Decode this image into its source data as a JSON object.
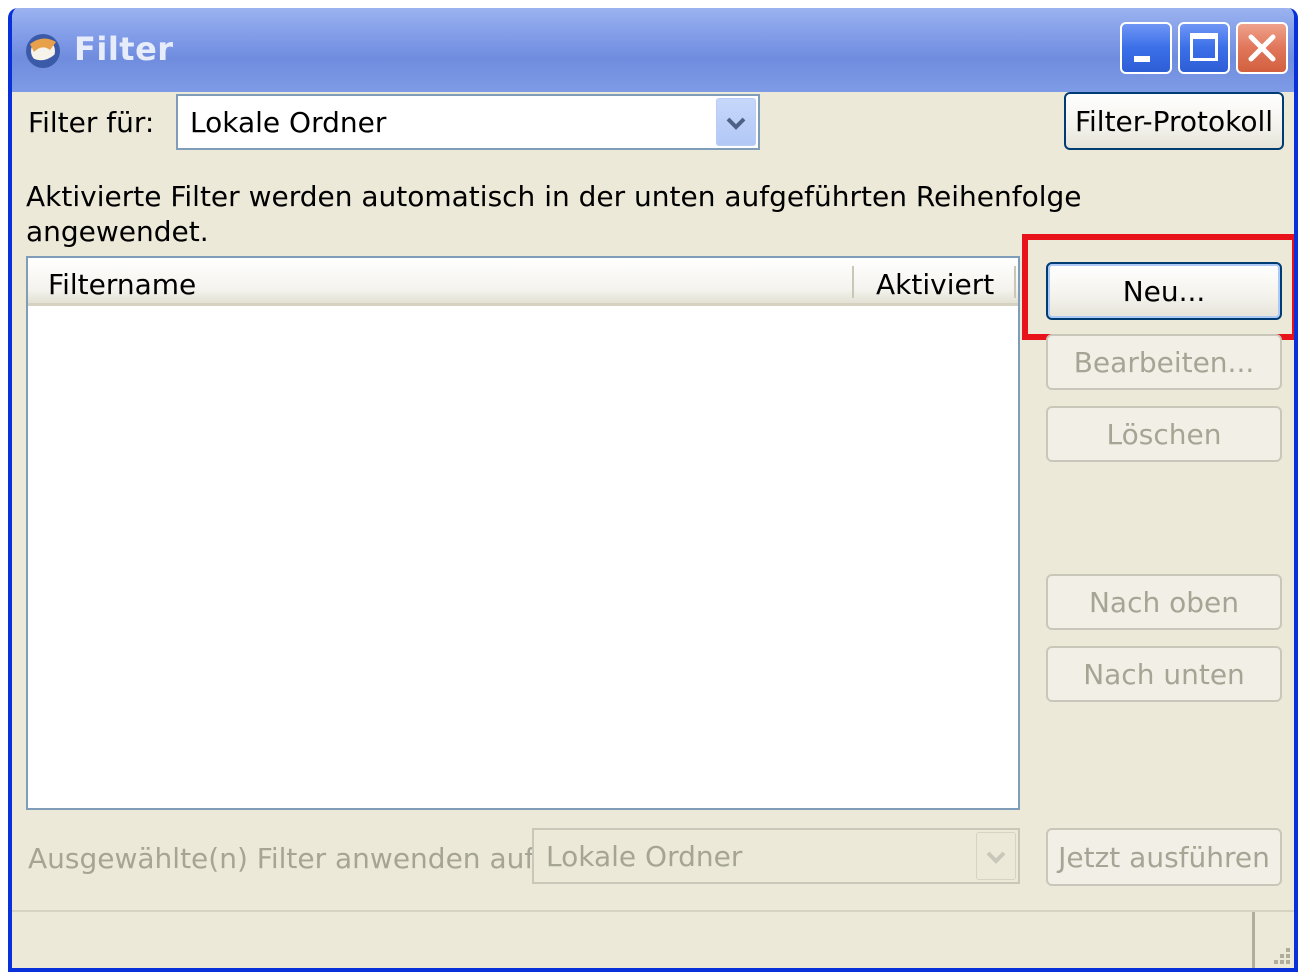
{
  "window": {
    "title": "Filter"
  },
  "filter_for": {
    "label": "Filter für:",
    "value": "Lokale Ordner"
  },
  "buttons": {
    "filter_log": "Filter-Protokoll",
    "new": "Neu...",
    "edit": "Bearbeiten...",
    "delete": "Löschen",
    "move_up": "Nach oben",
    "move_down": "Nach unten",
    "run_now": "Jetzt ausführen"
  },
  "description": {
    "line1": "Aktivierte Filter werden automatisch in der unten aufgeführten Reihenfolge",
    "line2": "angewendet."
  },
  "filter_list": {
    "columns": [
      "Filtername",
      "Aktiviert"
    ],
    "rows": []
  },
  "apply_to": {
    "label": "Ausgewählte(n) Filter anwenden auf:",
    "value": "Lokale Ordner"
  },
  "colors": {
    "highlight": "#e8131a",
    "titlebar": "#7d98e6",
    "dialog_bg": "#ece9d8"
  },
  "icons": [
    "app-icon",
    "minimize-icon",
    "maximize-icon",
    "close-icon",
    "chevron-down-icon",
    "resize-grip-icon"
  ]
}
